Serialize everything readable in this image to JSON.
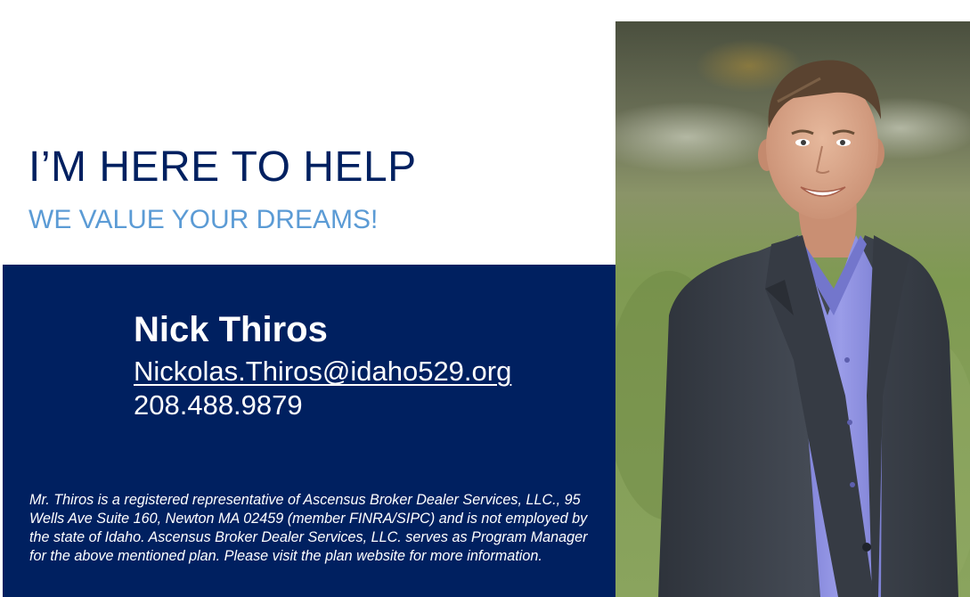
{
  "headline": "I’M HERE TO HELP",
  "subheadline": "WE VALUE YOUR DREAMS!",
  "contact": {
    "name": "Nick Thiros",
    "email": "Nickolas.Thiros@idaho529.org",
    "phone": "208.488.9879"
  },
  "disclaimer": "Mr. Thiros is a registered representative of Ascensus Broker Dealer Services, LLC., 95 Wells Ave Suite 160, Newton MA 02459 (member FINRA/SIPC) and is not employed by the state of Idaho.  Ascensus Broker Dealer Services, LLC. serves as Program Manager for the above mentioned plan.  Please visit the plan website for more information.",
  "photo": {
    "subject": "portrait-photo",
    "colors": {
      "background_green": "#7f9a52",
      "blazer": "#3b4049",
      "shirt": "#8d8fe0",
      "skin": "#d9a88d",
      "hair": "#5a4330"
    }
  },
  "colors": {
    "navy": "#002060",
    "headline": "#002060",
    "subheadline": "#5b9bd5",
    "white": "#ffffff"
  }
}
